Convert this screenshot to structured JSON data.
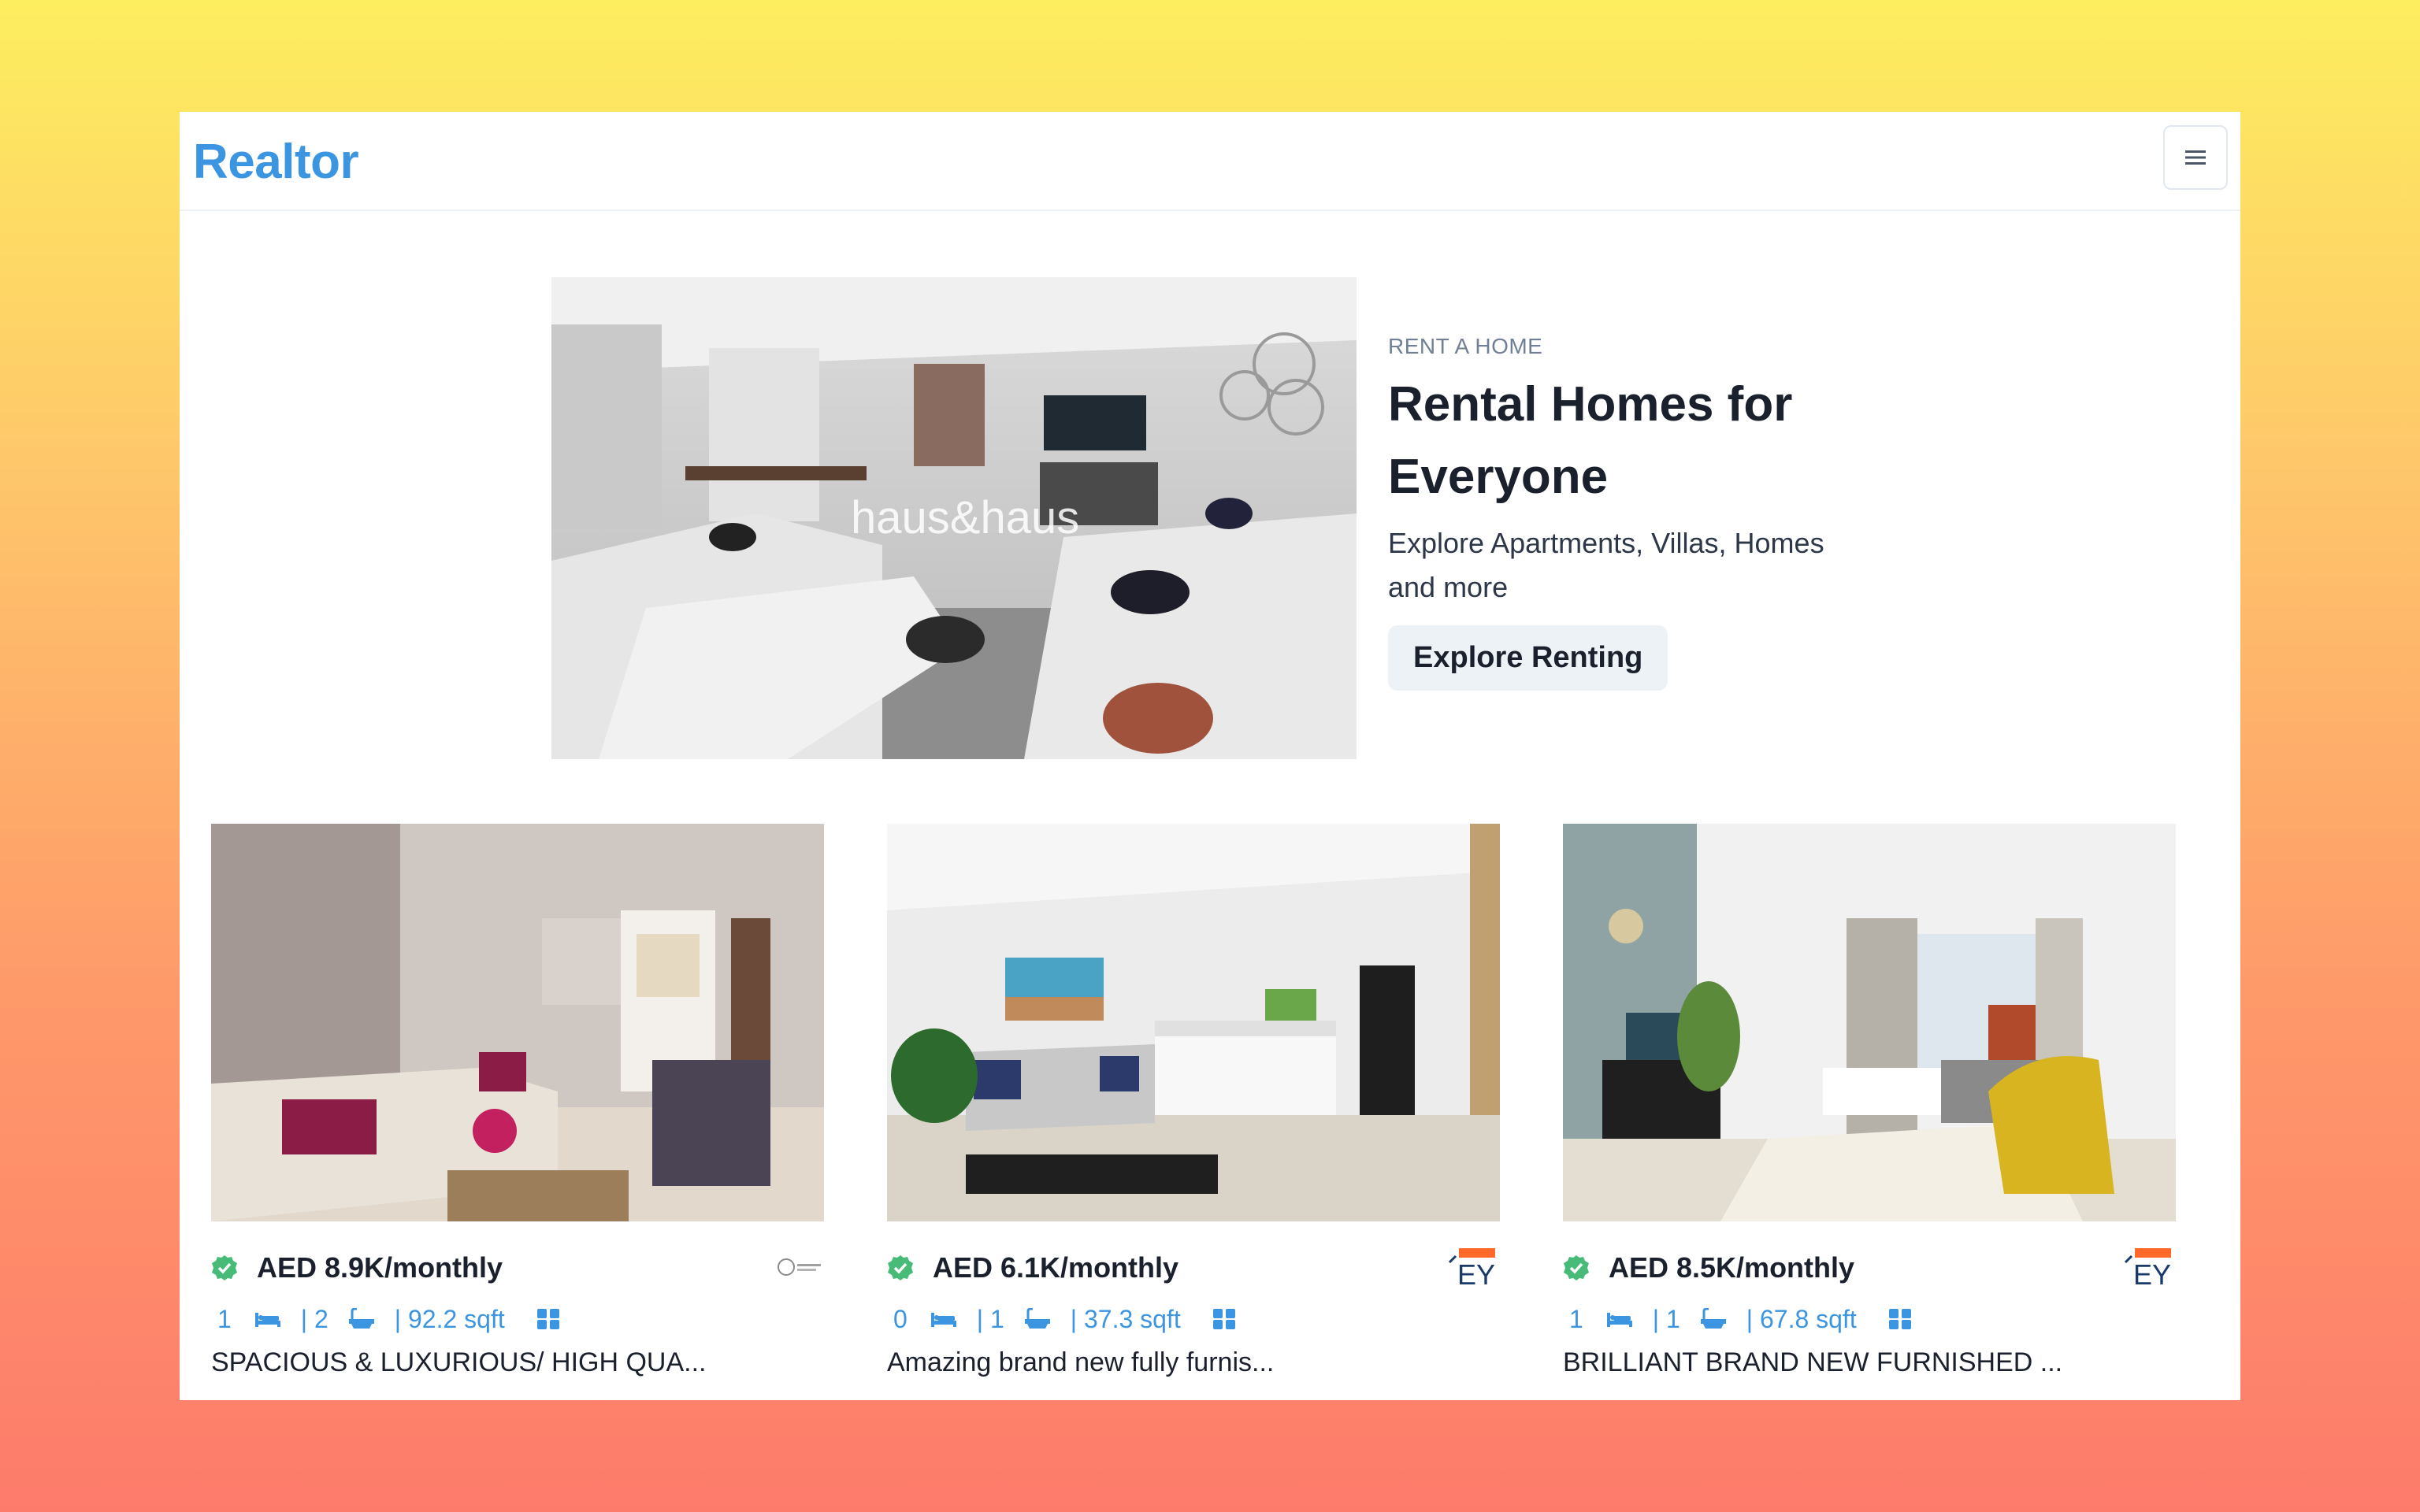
{
  "navbar": {
    "brand": "Realtor",
    "menu_icon": "hamburger-menu-icon"
  },
  "hero": {
    "eyebrow": "RENT A HOME",
    "title": "Rental Homes for Everyone",
    "subtitle": "Explore Apartments, Villas, Homes and more",
    "button_label": "Explore Renting",
    "image_watermark": "haus&haus"
  },
  "listings": [
    {
      "price": "AED 8.9K/monthly",
      "rooms": "1",
      "baths": "| 2",
      "area": "| 92.2 sqft",
      "title": "SPACIOUS & LUXURIOUS/ HIGH QUA...",
      "verified": true
    },
    {
      "price": "AED 6.1K/monthly",
      "rooms": "0",
      "baths": "| 1",
      "area": "| 37.3 sqft",
      "title": "Amazing brand new fully furnis...",
      "verified": true
    },
    {
      "price": "AED 8.5K/monthly",
      "rooms": "1",
      "baths": "| 1",
      "area": "| 67.8 sqft",
      "title": "BRILLIANT BRAND NEW FURNISHED ...",
      "verified": true
    }
  ],
  "colors": {
    "brand": "#3b95e0",
    "verified": "#48bb78",
    "text": "#1a202c"
  }
}
